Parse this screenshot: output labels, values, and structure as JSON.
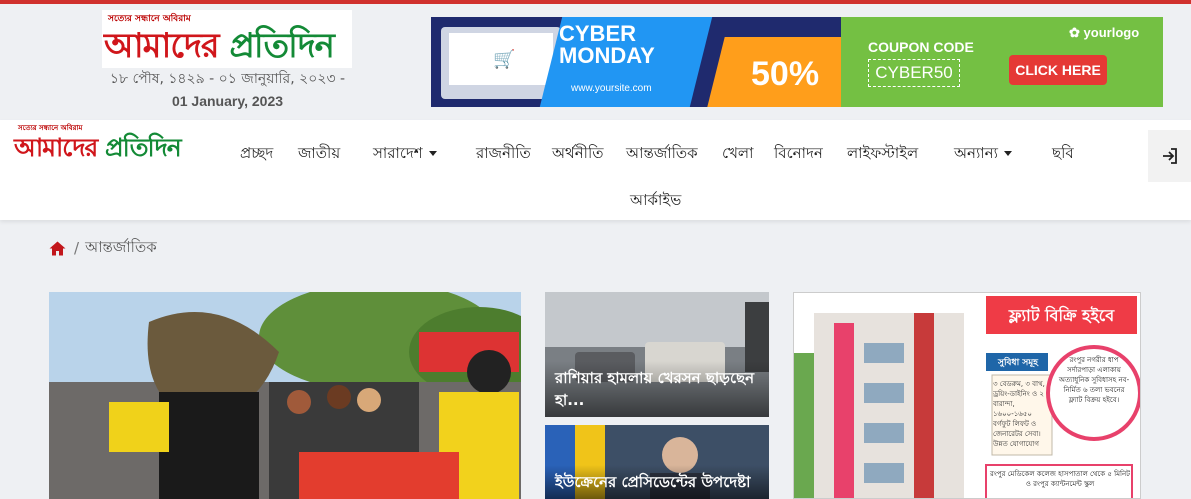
{
  "site": {
    "tagline": "সত্যের সন্ধানে অবিরাম",
    "logo_red": "আমাদের",
    "logo_green": "প্রতিদিন"
  },
  "header": {
    "date_bn": "১৮ পৌষ, ১৪২৯ - ০১ জানুয়ারি, ২০২৩ -",
    "date_en": "01 January, 2023"
  },
  "ad_banner": {
    "cyber": "CYBER",
    "monday": "MONDAY",
    "site": "www.yoursite.com",
    "percent": "50%",
    "coupon_label": "COUPON CODE",
    "coupon_code": "CYBER50",
    "cta": "CLICK HERE",
    "brand": "yourlogo"
  },
  "nav": {
    "items": [
      {
        "label": "প্রচ্ছদ"
      },
      {
        "label": "জাতীয়"
      },
      {
        "label": "সারাদেশ"
      },
      {
        "label": "রাজনীতি"
      },
      {
        "label": "অর্থনীতি"
      },
      {
        "label": "আন্তর্জাতিক"
      },
      {
        "label": "খেলা"
      },
      {
        "label": "বিনোদন"
      },
      {
        "label": "লাইফস্টাইল"
      },
      {
        "label": "অন্যান্য"
      },
      {
        "label": "ছবি"
      },
      {
        "label": "আর্কাইভ"
      }
    ],
    "login_icon": "login-icon"
  },
  "breadcrumb": {
    "home_icon": "home-icon",
    "separator": "/",
    "current": "আন্তর্জাতিক"
  },
  "articles": {
    "side": [
      {
        "title": "রাশিয়ার হামলায় খেরসন ছাড়ছেন হা..."
      },
      {
        "title": "ইউক্রেনের প্রেসিডেন্টের উপদেষ্টা"
      }
    ]
  },
  "right_ad": {
    "headline": "ফ্ল্যাট বিক্রি হইবে",
    "features_label": "সুবিধা সমূহ",
    "location": "রংপুর নগরীর ধাপ সর্দারপাড়া এলাকায় অত্যাধুনিক সুবিধাসহ নব-নির্মিত ৬ তলা ভবনের ফ্ল্যাট বিক্রয় হইবে।",
    "features": "৩ বেডরুম, ৩ বাথ, ড্রয়িং-ডাইনিং ও ২ বারান্দা, ১৬০০-১৬৫০ বর্গফুট লিফট ও জেনারেটর সেবা। উন্নত যোগাযোগ",
    "footer": "রংপুর মেডিকেল কলেজ হাসপাতাল থেকে ৫ মিনিট ও রংপুর ক্যান্টনমেন্ট স্কুল"
  },
  "colors": {
    "accent_red": "#d0161b",
    "accent_green": "#138a36"
  }
}
